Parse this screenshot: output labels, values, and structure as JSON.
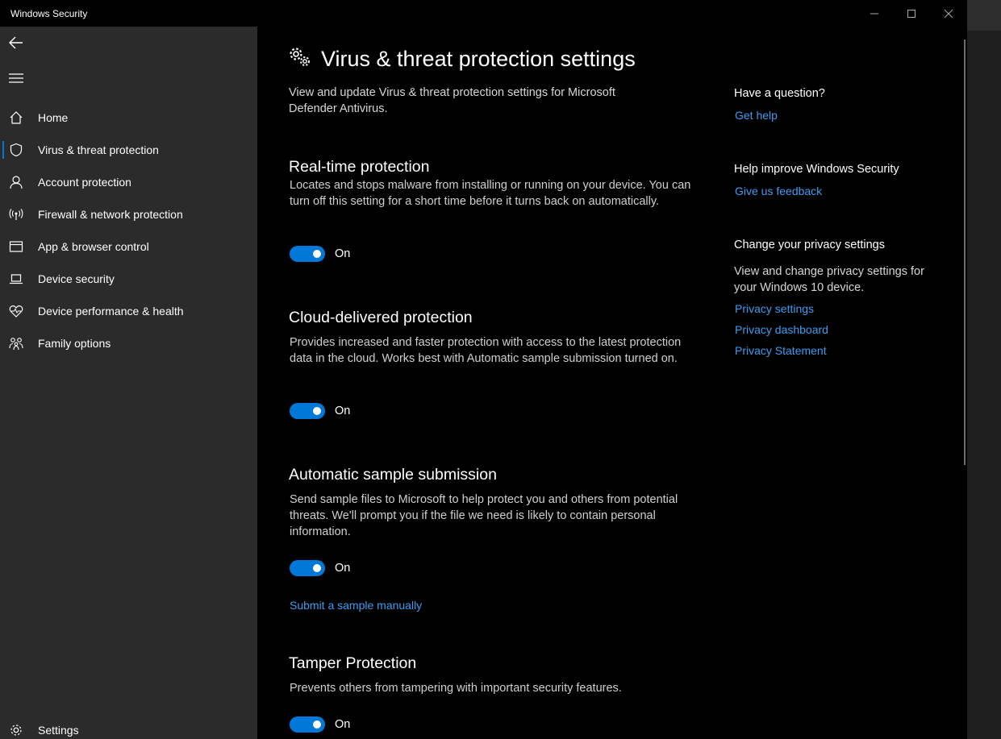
{
  "window": {
    "title": "Windows Security"
  },
  "sidebar": {
    "items": [
      {
        "label": "Home",
        "icon": "home-icon"
      },
      {
        "label": "Virus & threat protection",
        "icon": "shield-icon",
        "selected": true
      },
      {
        "label": "Account protection",
        "icon": "person-icon"
      },
      {
        "label": "Firewall & network protection",
        "icon": "antenna-icon"
      },
      {
        "label": "App & browser control",
        "icon": "app-window-icon"
      },
      {
        "label": "Device security",
        "icon": "laptop-icon"
      },
      {
        "label": "Device performance & health",
        "icon": "heart-pulse-icon"
      },
      {
        "label": "Family options",
        "icon": "family-icon"
      }
    ],
    "settings_label": "Settings"
  },
  "main": {
    "title": "Virus & threat protection settings",
    "description": "View and update Virus & threat protection settings for Microsoft Defender Antivirus.",
    "sections": [
      {
        "title": "Real-time protection",
        "description": "Locates and stops malware from installing or running on your device. You can turn off this setting for a short time before it turns back on automatically.",
        "toggle_state": "On"
      },
      {
        "title": "Cloud-delivered protection",
        "description": "Provides increased and faster protection with access to the latest protection data in the cloud. Works best with Automatic sample submission turned on.",
        "toggle_state": "On"
      },
      {
        "title": "Automatic sample submission",
        "description": "Send sample files to Microsoft to help protect you and others from potential threats. We'll prompt you if the file we need is likely to contain personal information.",
        "toggle_state": "On",
        "link": "Submit a sample manually"
      },
      {
        "title": "Tamper Protection",
        "description": "Prevents others from tampering with important security features.",
        "toggle_state": "On"
      }
    ]
  },
  "right": {
    "question_heading": "Have a question?",
    "get_help": "Get help",
    "improve_heading": "Help improve Windows Security",
    "feedback": "Give us feedback",
    "privacy_heading": "Change your privacy settings",
    "privacy_text": "View and change privacy settings for your Windows 10 device.",
    "links": [
      "Privacy settings",
      "Privacy dashboard",
      "Privacy Statement"
    ]
  },
  "colors": {
    "accent": "#0078d7",
    "link": "#3c9df0",
    "sidebar_bg": "#2b2b2b",
    "main_bg": "#000000"
  }
}
